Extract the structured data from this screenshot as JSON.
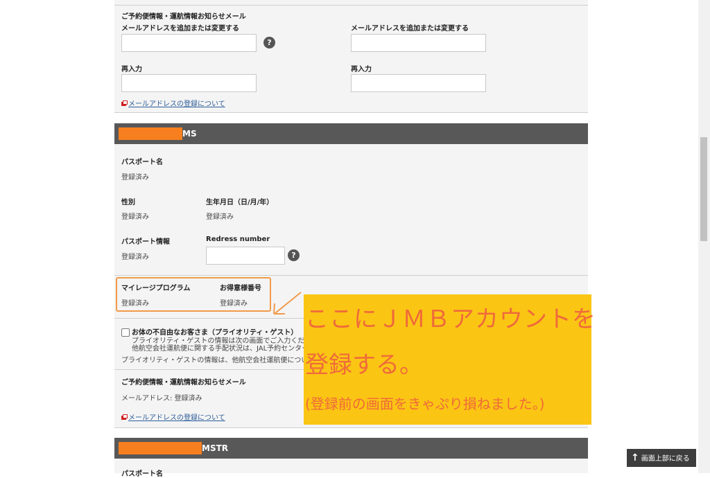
{
  "notify_section_1": {
    "title": "ご予約便情報・運航情報お知らせメール",
    "email_label_left": "メールアドレスを追加または変更する",
    "email_label_right": "メールアドレスを追加または変更する",
    "reenter_label_left": "再入力",
    "reenter_label_right": "再入力",
    "help": "?",
    "link": "メールアドレスの登録について"
  },
  "passenger_1": {
    "name_suffix": "MS",
    "passport_name_label": "パスポート名",
    "passport_name_value": "登録済み",
    "gender_label": "性別",
    "gender_value": "登録済み",
    "dob_label": "生年月日（日/月/年）",
    "dob_value": "登録済み",
    "passport_info_label": "パスポート情報",
    "passport_info_value": "登録済み",
    "redress_label": "Redress number",
    "help": "?",
    "mileage_label": "マイレージプログラム",
    "mileage_value": "登録済み",
    "member_label": "お得意様番号",
    "member_value": "登録済み",
    "priority_label": "お体の不自由なお客さま（プライオリティ・ゲスト）",
    "priority_desc_1": "プライオリティ・ゲストの情報は次の画面でご入力くだ",
    "priority_desc_2": "他航空会社運航便に関する手配状況は、JAL予約センター",
    "priority_note": "プライオリティ・ゲストの情報は、他航空会社運航便につい",
    "notify_title": "ご予約便情報・運航情報お知らせメール",
    "email_status": "メールアドレス: 登録済み",
    "link": "メールアドレスの登録について"
  },
  "passenger_2": {
    "name_suffix": "MSTR",
    "passport_name_label": "パスポート名"
  },
  "annotation": {
    "line1": "ここにＪＭＢアカウントを",
    "line2": "登録する。",
    "line3": "(登録前の画面をきゃぷり損ねました。)"
  },
  "back_to_top": {
    "arrow": "↑",
    "label": "画面上部に戻る"
  },
  "colors": {
    "section_bar": "#585858",
    "redaction": "#f77f1f",
    "note_bg": "#fbc514",
    "note_text": "#ef6a3a",
    "link": "#2a5c99"
  }
}
